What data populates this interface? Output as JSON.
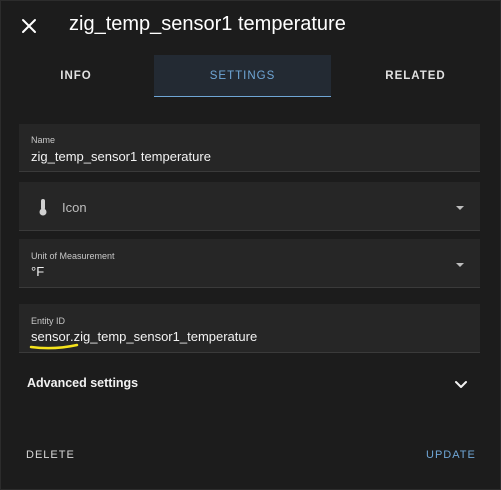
{
  "header": {
    "title": "zig_temp_sensor1 temperature",
    "close_icon": "close-icon"
  },
  "tabs": [
    {
      "label": "INFO",
      "active": false
    },
    {
      "label": "SETTINGS",
      "active": true
    },
    {
      "label": "RELATED",
      "active": false
    }
  ],
  "fields": {
    "name": {
      "label": "Name",
      "value": "zig_temp_sensor1 temperature"
    },
    "icon": {
      "placeholder": "Icon",
      "icon": "thermometer-icon"
    },
    "unit": {
      "label": "Unit of Measurement",
      "value": "°F"
    },
    "entity_id": {
      "label": "Entity ID",
      "prefix": "sensor",
      "rest": ".zig_temp_sensor1_temperature"
    }
  },
  "advanced": {
    "label": "Advanced settings",
    "icon": "chevron-down-icon"
  },
  "footer": {
    "delete_label": "DELETE",
    "update_label": "UPDATE"
  },
  "colors": {
    "accent": "#6fa6d6",
    "highlight": "#f5e31c",
    "background": "#1c1c1c",
    "field": "#262626"
  }
}
